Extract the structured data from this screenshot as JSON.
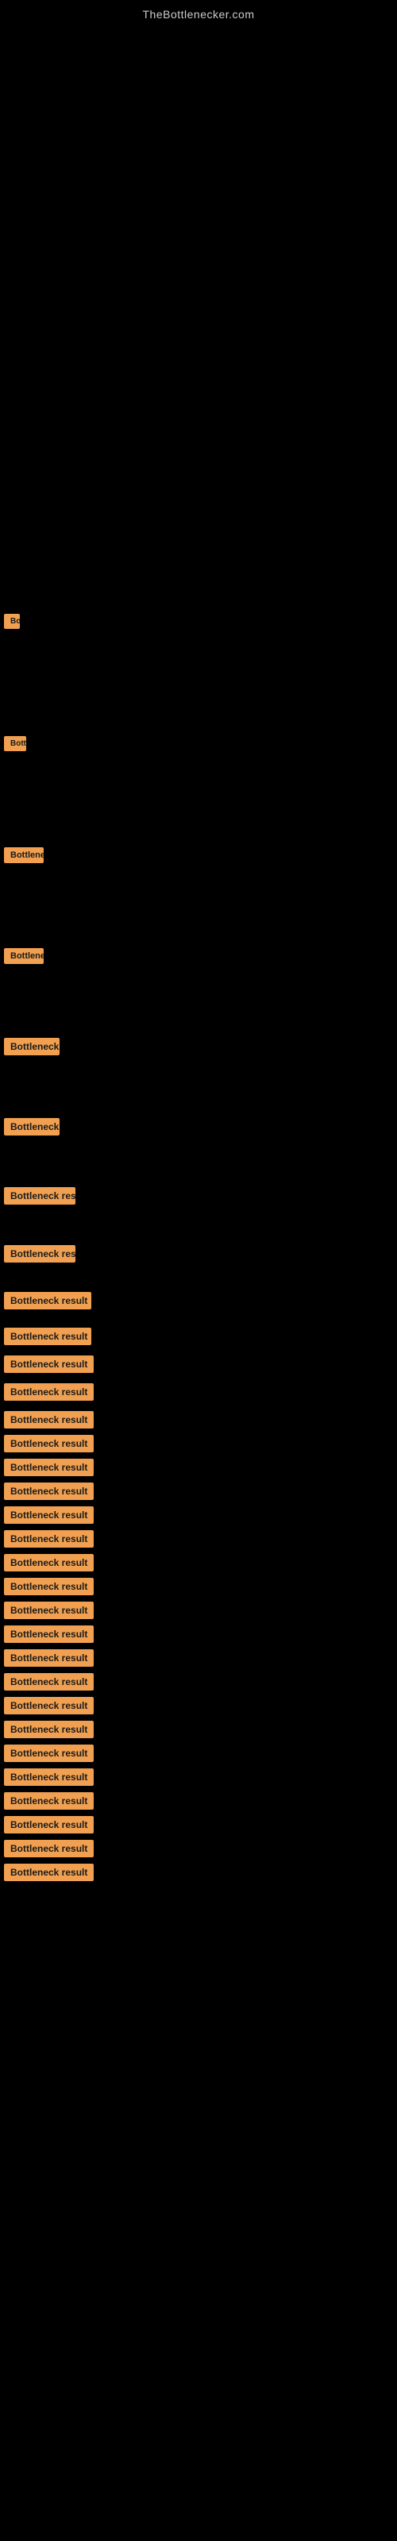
{
  "site": {
    "title": "TheBottlenecker.com"
  },
  "items": [
    {
      "label": "Bottleneck result",
      "size": "very-tiny"
    },
    {
      "label": "Bottleneck result",
      "size": "tiny"
    },
    {
      "label": "Bottleneck result",
      "size": "small"
    },
    {
      "label": "Bottleneck result",
      "size": "small"
    },
    {
      "label": "Bottleneck result",
      "size": "medium-small"
    },
    {
      "label": "Bottleneck result",
      "size": "medium-small"
    },
    {
      "label": "Bottleneck result",
      "size": "medium"
    },
    {
      "label": "Bottleneck result",
      "size": "medium"
    },
    {
      "label": "Bottleneck result",
      "size": "medium-large"
    },
    {
      "label": "Bottleneck result",
      "size": "medium-large"
    },
    {
      "label": "Bottleneck result",
      "size": "large"
    },
    {
      "label": "Bottleneck result",
      "size": "large"
    },
    {
      "label": "Bottleneck result",
      "size": "full"
    },
    {
      "label": "Bottleneck result",
      "size": "full"
    },
    {
      "label": "Bottleneck result",
      "size": "full"
    },
    {
      "label": "Bottleneck result",
      "size": "full"
    },
    {
      "label": "Bottleneck result",
      "size": "full"
    },
    {
      "label": "Bottleneck result",
      "size": "full"
    },
    {
      "label": "Bottleneck result",
      "size": "full"
    },
    {
      "label": "Bottleneck result",
      "size": "full"
    },
    {
      "label": "Bottleneck result",
      "size": "full"
    },
    {
      "label": "Bottleneck result",
      "size": "full"
    },
    {
      "label": "Bottleneck result",
      "size": "full"
    },
    {
      "label": "Bottleneck result",
      "size": "full"
    },
    {
      "label": "Bottleneck result",
      "size": "full"
    },
    {
      "label": "Bottleneck result",
      "size": "full"
    },
    {
      "label": "Bottleneck result",
      "size": "full"
    },
    {
      "label": "Bottleneck result",
      "size": "full"
    },
    {
      "label": "Bottleneck result",
      "size": "full"
    },
    {
      "label": "Bottleneck result",
      "size": "full"
    },
    {
      "label": "Bottleneck result",
      "size": "full"
    },
    {
      "label": "Bottleneck result",
      "size": "full"
    }
  ]
}
